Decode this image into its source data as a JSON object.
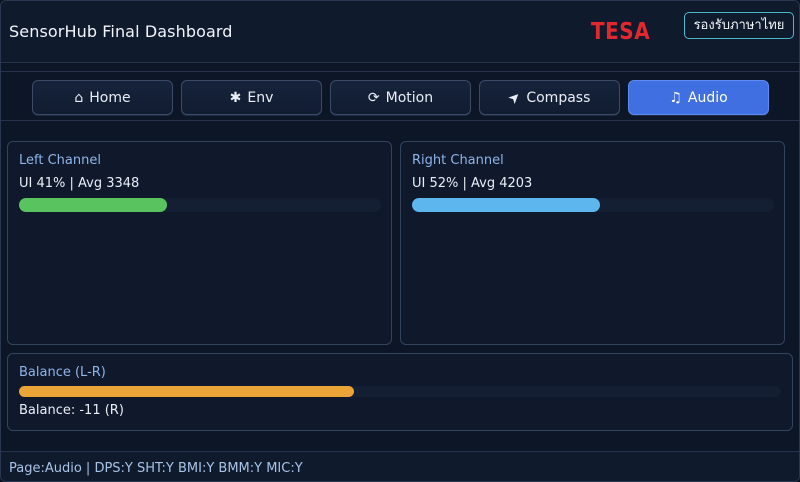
{
  "header": {
    "title": "SensorHub Final Dashboard",
    "logo_text": "TESA",
    "lang_button": "รองรับภาษาไทย"
  },
  "tabs": [
    {
      "label": "Home",
      "icon": "home-icon",
      "glyph": "⌂",
      "active": false
    },
    {
      "label": "Env",
      "icon": "gear-icon",
      "glyph": "✱",
      "active": false
    },
    {
      "label": "Motion",
      "icon": "refresh-icon",
      "glyph": "⟳",
      "active": false
    },
    {
      "label": "Compass",
      "icon": "location-arrow-icon",
      "glyph": "➤",
      "active": false
    },
    {
      "label": "Audio",
      "icon": "music-note-icon",
      "glyph": "♫",
      "active": true
    }
  ],
  "left_channel": {
    "title": "Left Channel",
    "value_text": "UI 41% | Avg 3348",
    "level": 0.41
  },
  "right_channel": {
    "title": "Right Channel",
    "value_text": "UI 52% | Avg 4203",
    "level": 0.52
  },
  "balance": {
    "title": "Balance (L-R)",
    "value_text": "Balance: -11 (R)",
    "level": 0.44
  },
  "status": {
    "text": "Page:Audio | DPS:Y SHT:Y BMI:Y BMM:Y MIC:Y"
  },
  "colors": {
    "accent": "#3f6fe0",
    "left_bar": "#58c35f",
    "right_bar": "#5db6ee",
    "balance_bar": "#eba437",
    "logo": "#e0282e"
  }
}
